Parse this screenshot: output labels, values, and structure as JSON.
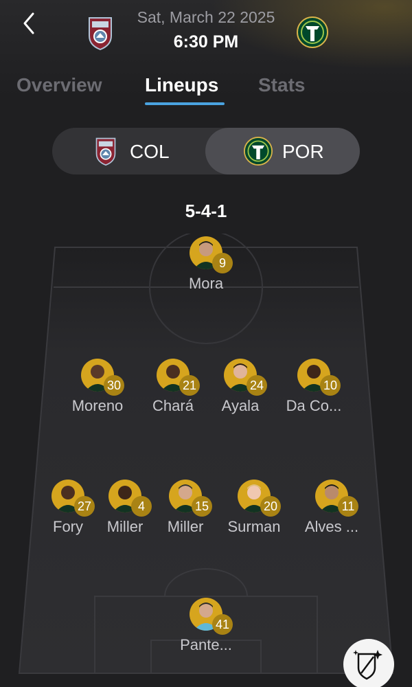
{
  "header": {
    "date": "Sat, March 22 2025",
    "time": "6:30 PM",
    "home_crest": "colorado-rapids-crest-icon",
    "away_crest": "portland-timbers-crest-icon"
  },
  "tabs": [
    {
      "label": "Overview",
      "active": false
    },
    {
      "label": "Lineups",
      "active": true
    },
    {
      "label": "Stats",
      "active": false
    }
  ],
  "team_toggle": {
    "home": {
      "label": "COL",
      "selected": false
    },
    "away": {
      "label": "POR",
      "selected": true
    }
  },
  "lineup": {
    "formation": "5-4-1",
    "players": [
      {
        "number": "9",
        "name": "Mora"
      },
      {
        "number": "30",
        "name": "Moreno"
      },
      {
        "number": "21",
        "name": "Chará"
      },
      {
        "number": "24",
        "name": "Ayala"
      },
      {
        "number": "10",
        "name": "Da Co..."
      },
      {
        "number": "27",
        "name": "Fory"
      },
      {
        "number": "4",
        "name": "Miller"
      },
      {
        "number": "15",
        "name": "Miller"
      },
      {
        "number": "20",
        "name": "Surman"
      },
      {
        "number": "11",
        "name": "Alves ..."
      },
      {
        "number": "41",
        "name": "Pante..."
      }
    ]
  },
  "colors": {
    "background": "#1f1f21",
    "accent_underline": "#4aa3e0",
    "player_photo_bg": "#d6a51e",
    "number_badge": "#a98314",
    "timbers_green": "#00482b",
    "rapids_burgundy": "#8a2432"
  },
  "fab": {
    "icon": "mls-sparkle-shield-icon"
  }
}
